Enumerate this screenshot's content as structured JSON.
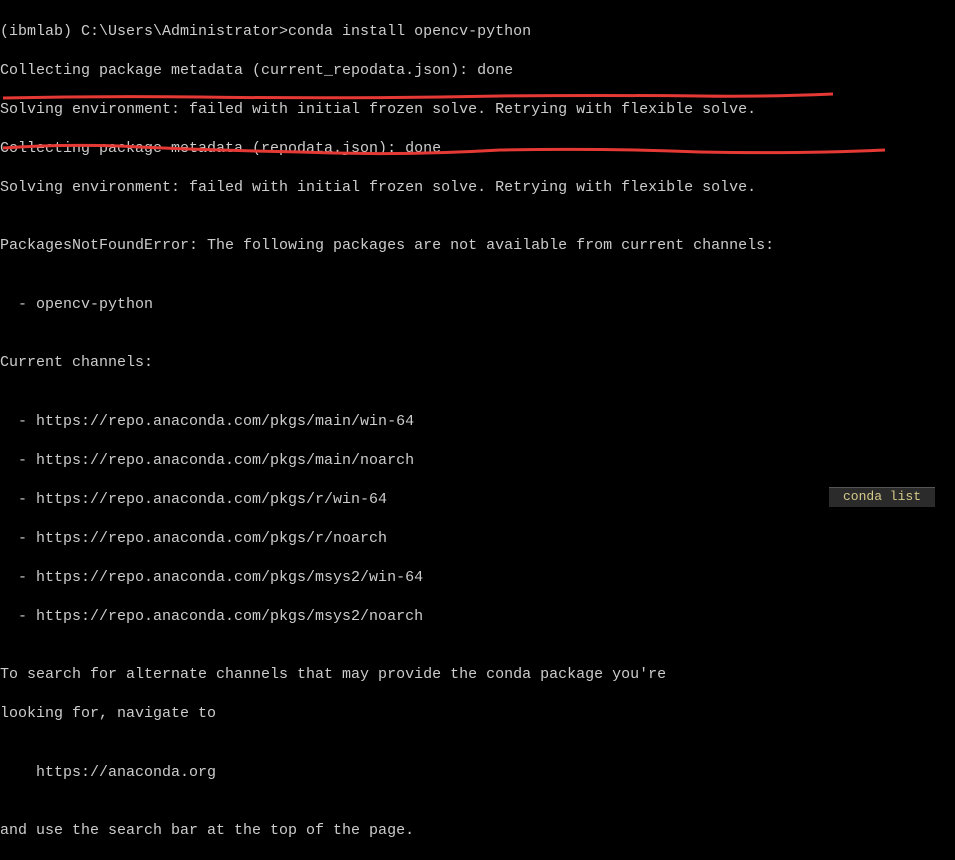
{
  "terminal": {
    "lines": [
      "(ibmlab) C:\\Users\\Administrator>conda install opencv-python",
      "Collecting package metadata (current_repodata.json): done",
      "Solving environment: failed with initial frozen solve. Retrying with flexible solve.",
      "Collecting package metadata (repodata.json): done",
      "Solving environment: failed with initial frozen solve. Retrying with flexible solve.",
      "",
      "PackagesNotFoundError: The following packages are not available from current channels:",
      "",
      "  - opencv-python",
      "",
      "Current channels:",
      "",
      "  - https://repo.anaconda.com/pkgs/main/win-64",
      "  - https://repo.anaconda.com/pkgs/main/noarch",
      "  - https://repo.anaconda.com/pkgs/r/win-64",
      "  - https://repo.anaconda.com/pkgs/r/noarch",
      "  - https://repo.anaconda.com/pkgs/msys2/win-64",
      "  - https://repo.anaconda.com/pkgs/msys2/noarch",
      "",
      "To search for alternate channels that may provide the conda package you're",
      "looking for, navigate to",
      "",
      "    https://anaconda.org",
      "",
      "and use the search bar at the top of the page."
    ]
  },
  "taskbar": {
    "text": "conda list"
  }
}
